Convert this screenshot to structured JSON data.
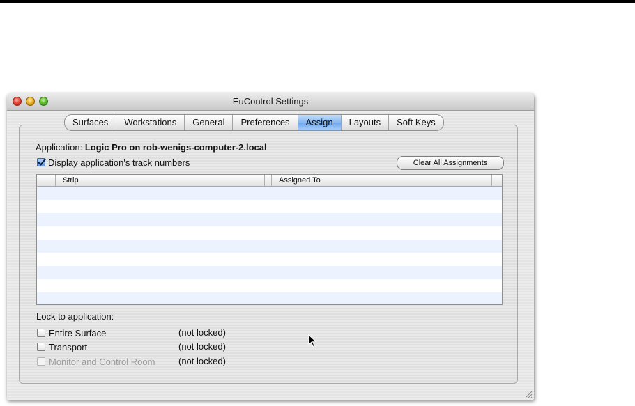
{
  "window": {
    "title": "EuControl Settings"
  },
  "tabs": [
    {
      "label": "Surfaces",
      "selected": false
    },
    {
      "label": "Workstations",
      "selected": false
    },
    {
      "label": "General",
      "selected": false
    },
    {
      "label": "Preferences",
      "selected": false
    },
    {
      "label": "Assign",
      "selected": true
    },
    {
      "label": "Layouts",
      "selected": false
    },
    {
      "label": "Soft Keys",
      "selected": false
    }
  ],
  "assign": {
    "application_label": "Application:",
    "application_value": "Logic Pro on rob-wenigs-computer-2.local",
    "display_track_numbers_label": "Display application's track numbers",
    "display_track_numbers_checked": true,
    "clear_button_label": "Clear All Assignments",
    "table": {
      "columns": [
        "Strip",
        "Assigned To"
      ],
      "rows": []
    },
    "lock_heading": "Lock to application:",
    "locks": [
      {
        "label": "Entire Surface",
        "status": "(not locked)",
        "checked": false,
        "enabled": true
      },
      {
        "label": "Transport",
        "status": "(not locked)",
        "checked": false,
        "enabled": true
      },
      {
        "label": "Monitor and Control Room",
        "status": "(not locked)",
        "checked": false,
        "enabled": false
      }
    ]
  },
  "colors": {
    "selected_tab": "#87b6ef",
    "row_stripe": "#edf3fe"
  }
}
